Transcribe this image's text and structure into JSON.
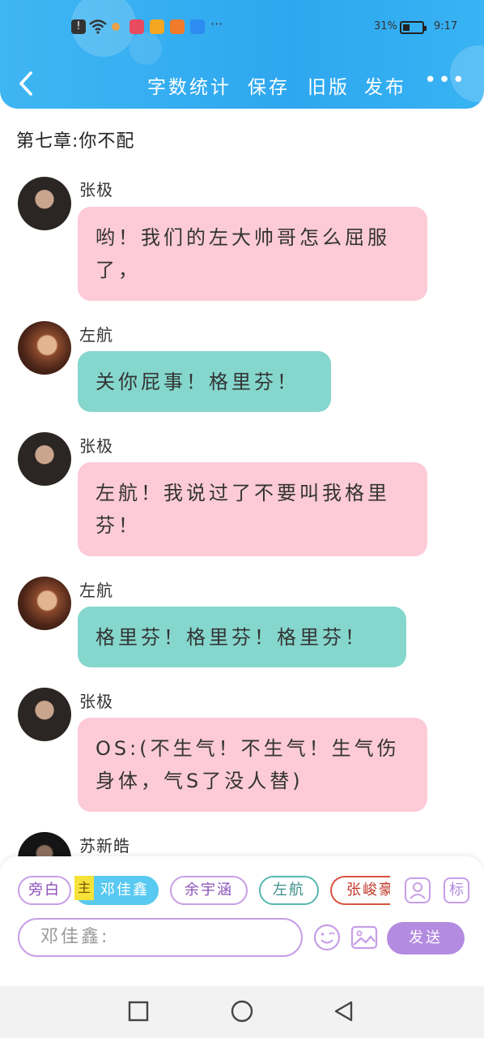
{
  "status_bar": {
    "battery": "31%",
    "time": "9:17",
    "more_notifications": "···"
  },
  "toolbar": {
    "word_count": "字数统计",
    "save": "保存",
    "old_version": "旧版",
    "publish": "发布"
  },
  "chapter_title": "第七章:你不配",
  "messages": [
    {
      "sender": "张极",
      "text": "哟！我们的左大帅哥怎么屈服了，",
      "color": "#fccbd7"
    },
    {
      "sender": "左航",
      "text": "关你屁事！格里芬！",
      "color": "#85d7cd"
    },
    {
      "sender": "张极",
      "text": "左航！我说过了不要叫我格里芬！",
      "color": "#fccbd7"
    },
    {
      "sender": "左航",
      "text": "格里芬！格里芬！格里芬！",
      "color": "#85d7cd"
    },
    {
      "sender": "张极",
      "text": "OS:(不生气！不生气！生气伤身体，气S了没人替)",
      "color": "#fccbd7"
    },
    {
      "sender": "苏新皓",
      "text": ""
    }
  ],
  "roles": {
    "narration": "旁白",
    "main_tag": "主",
    "items": [
      "邓佳鑫",
      "余宇涵",
      "左航",
      "张峻豪"
    ]
  },
  "role_icon_label": "标",
  "input": {
    "value": "邓佳鑫:"
  },
  "send_label": "发送",
  "colors": {
    "header": "#2ea7f0",
    "pink_bubble": "#fccbd7",
    "teal_bubble": "#85d7cd",
    "accent_purple": "#b38be0"
  }
}
